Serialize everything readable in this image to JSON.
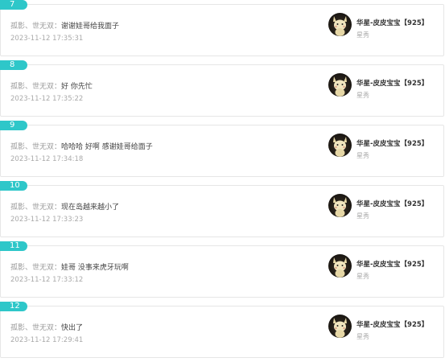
{
  "comments": [
    {
      "number": "7",
      "author": "孤影、世无双",
      "separator": "：",
      "text": "谢谢娃哥给我面子",
      "time": "2023-11-12 17:35:31",
      "target_user": "华星-皮皮宝宝【925】",
      "target_role": "星秀"
    },
    {
      "number": "8",
      "author": "孤影、世无双",
      "separator": "：",
      "text": "好 你先忙",
      "time": "2023-11-12 17:35:22",
      "target_user": "华星-皮皮宝宝【925】",
      "target_role": "星秀"
    },
    {
      "number": "9",
      "author": "孤影、世无双",
      "separator": "：",
      "text": "哈哈哈 好啊 感谢娃哥给面子",
      "time": "2023-11-12 17:34:18",
      "target_user": "华星-皮皮宝宝【925】",
      "target_role": "星秀"
    },
    {
      "number": "10",
      "author": "孤影、世无双",
      "separator": "：",
      "text": "现在岛越来越小了",
      "time": "2023-11-12 17:33:23",
      "target_user": "华星-皮皮宝宝【925】",
      "target_role": "星秀"
    },
    {
      "number": "11",
      "author": "孤影、世无双",
      "separator": "：",
      "text": "娃哥 没事来虎牙玩啊",
      "time": "2023-11-12 17:33:12",
      "target_user": "华星-皮皮宝宝【925】",
      "target_role": "星秀"
    },
    {
      "number": "12",
      "author": "孤影、世无双",
      "separator": "：",
      "text": "快出了",
      "time": "2023-11-12 17:29:41",
      "target_user": "华星-皮皮宝宝【925】",
      "target_role": "星秀"
    }
  ],
  "colors": {
    "badge": "#2ec7c9",
    "border": "#e6e6e6"
  }
}
